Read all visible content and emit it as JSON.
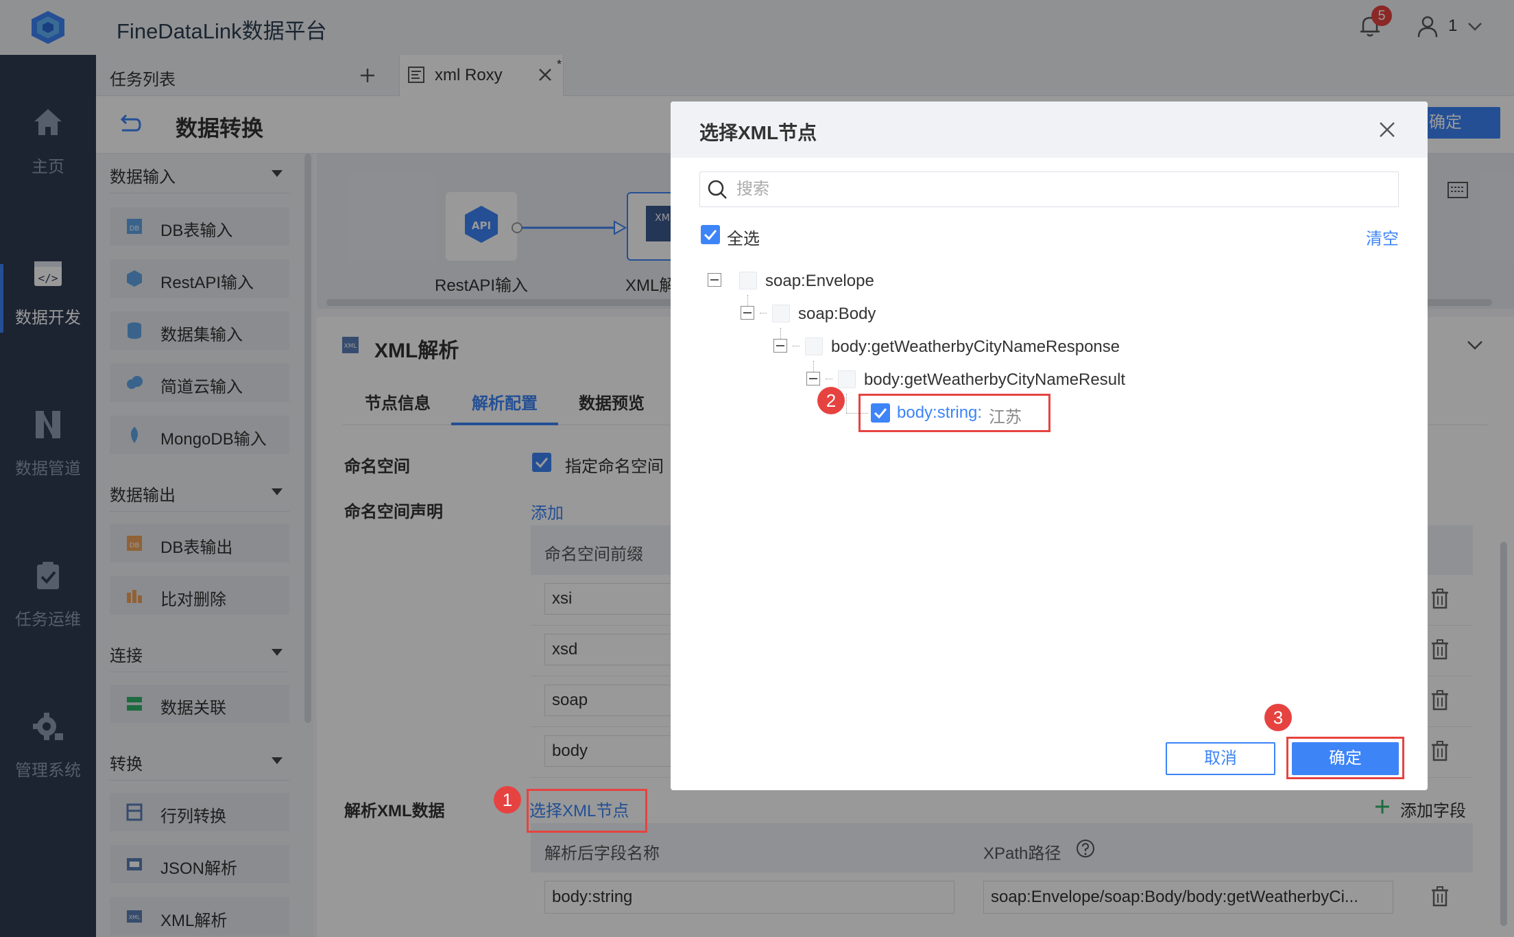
{
  "app": {
    "title": "FineDataLink数据平台",
    "notification_count": "5",
    "user_name": "1"
  },
  "nav": {
    "items": [
      "主页",
      "数据开发",
      "数据管道",
      "任务运维",
      "管理系统"
    ]
  },
  "tabs": {
    "task_list": "任务列表",
    "xml_tab": "xml Roxy",
    "unsaved_mark": "*"
  },
  "subheader": {
    "title": "数据转换",
    "confirm": "确定"
  },
  "palette": {
    "groups": [
      "数据输入",
      "数据输出",
      "连接",
      "转换"
    ],
    "items": [
      "DB表输入",
      "RestAPI输入",
      "数据集输入",
      "简道云输入",
      "MongoDB输入",
      "DB表输出",
      "比对删除",
      "数据关联",
      "行列转换",
      "JSON解析",
      "XML解析"
    ]
  },
  "canvas": {
    "node_api": "RestAPI输入",
    "node_xml": "XML解",
    "api_icon_text": "API",
    "xml_icon_text": "XM"
  },
  "config": {
    "title": "XML解析",
    "tabs": [
      "节点信息",
      "解析配置",
      "数据预览"
    ],
    "namespace_label": "命名空间",
    "namespace_checkbox": "指定命名空间",
    "namespace_decl_label": "命名空间声明",
    "add_link": "添加",
    "ns_column": "命名空间前缀",
    "ns_rows": [
      "xsi",
      "xsd",
      "soap",
      "body"
    ],
    "parse_label": "解析XML数据",
    "select_node_link": "选择XML节点",
    "add_field": "添加字段",
    "field_col_name": "解析后字段名称",
    "field_col_xpath": "XPath路径",
    "field_name": "body:string",
    "field_xpath": "soap:Envelope/soap:Body/body:getWeatherbyCi..."
  },
  "modal": {
    "title": "选择XML节点",
    "search_placeholder": "搜索",
    "select_all": "全选",
    "clear": "清空",
    "tree": [
      "soap:Envelope",
      "soap:Body",
      "body:getWeatherbyCityNameResponse",
      "body:getWeatherbyCityNameResult"
    ],
    "leaf_label": "body:string:",
    "leaf_value": "江苏",
    "cancel": "取消",
    "ok": "确定"
  },
  "annotations": [
    "1",
    "2",
    "3"
  ],
  "colors": {
    "accent": "#3d84f7",
    "highlight": "#e64340",
    "nav_bg": "#2f3b52"
  }
}
